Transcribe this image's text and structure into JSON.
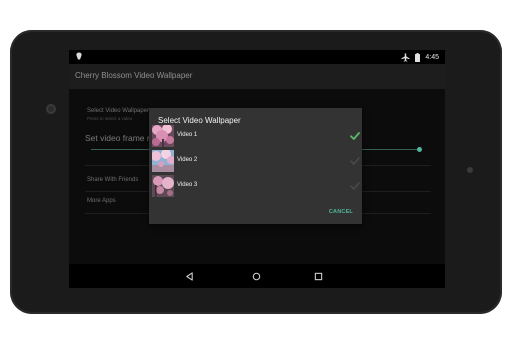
{
  "status_bar": {
    "time": "4:45",
    "icons": [
      "notification-icon",
      "airplane-icon",
      "battery-icon"
    ]
  },
  "app": {
    "title": "Cherry Blossom Video Wallpaper"
  },
  "preferences": {
    "select_video": {
      "title": "Select Video Wallpaper",
      "summary": "Press to select a video"
    },
    "frame_rate": {
      "title": "Set video frame rate"
    },
    "share": {
      "title": "Share With Friends"
    },
    "more_apps": {
      "title": "More Apps"
    }
  },
  "dialog": {
    "title": "Select Video Wallpaper",
    "items": [
      {
        "label": "Video 1",
        "selected": true
      },
      {
        "label": "Video 2",
        "selected": false
      },
      {
        "label": "Video 3",
        "selected": false
      }
    ],
    "cancel_label": "CANCEL"
  },
  "navigation": {
    "icons": [
      "back-icon",
      "home-icon",
      "recents-icon"
    ]
  },
  "colors": {
    "accent": "#4fb79a",
    "dialog_bg": "#333333",
    "screen_bg": "#000000"
  }
}
